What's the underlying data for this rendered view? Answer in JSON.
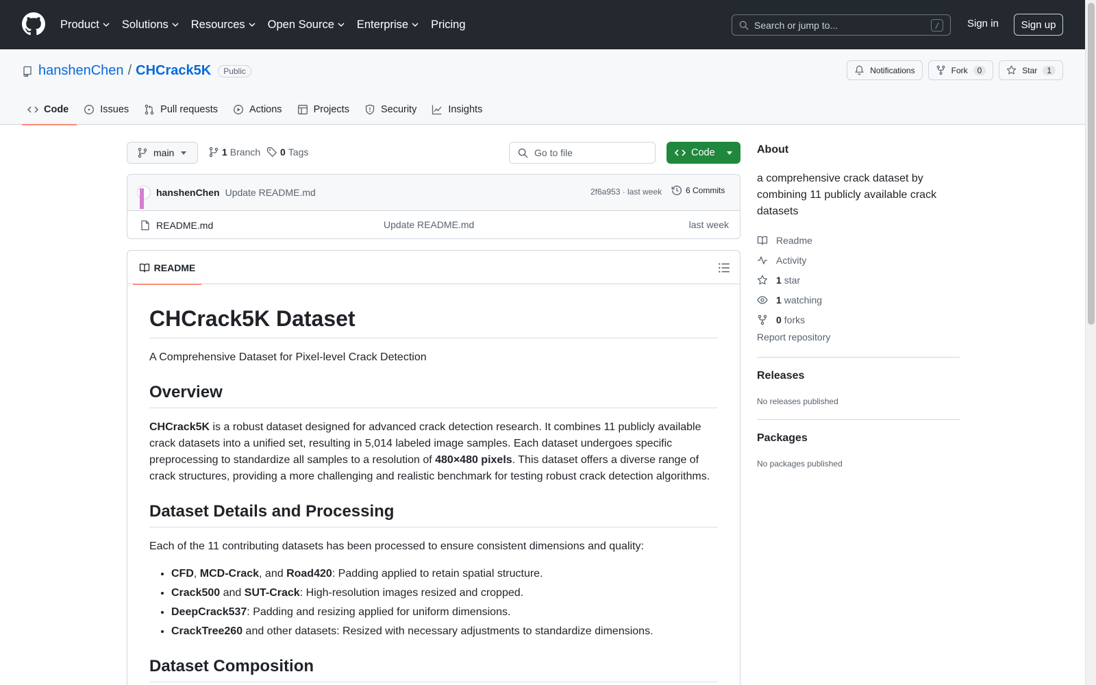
{
  "header": {
    "nav": [
      "Product",
      "Solutions",
      "Resources",
      "Open Source",
      "Enterprise",
      "Pricing"
    ],
    "search_placeholder": "Search or jump to...",
    "search_key": "/",
    "sign_in": "Sign in",
    "sign_up": "Sign up"
  },
  "repo": {
    "owner": "hanshenChen",
    "separator": "/",
    "name": "CHCrack5K",
    "visibility": "Public",
    "notifications_label": "Notifications",
    "fork_label": "Fork",
    "fork_count": "0",
    "star_label": "Star",
    "star_count": "1"
  },
  "tabs": [
    {
      "label": "Code",
      "icon": "code-icon"
    },
    {
      "label": "Issues",
      "icon": "issue-icon"
    },
    {
      "label": "Pull requests",
      "icon": "pull-request-icon"
    },
    {
      "label": "Actions",
      "icon": "play-icon"
    },
    {
      "label": "Projects",
      "icon": "table-icon"
    },
    {
      "label": "Security",
      "icon": "shield-icon"
    },
    {
      "label": "Insights",
      "icon": "graph-icon"
    }
  ],
  "toolbar": {
    "branch": "main",
    "branch_count": "1",
    "branch_label": "Branch",
    "tag_count": "0",
    "tag_label": "Tags",
    "goto_placeholder": "Go to file",
    "code_label": "Code"
  },
  "commit": {
    "author": "hanshenChen",
    "message": "Update README.md",
    "hash_time": "2f6a953 · last week",
    "commits_label": "6 Commits"
  },
  "files": [
    {
      "name": "README.md",
      "commit": "Update README.md",
      "time": "last week"
    }
  ],
  "readme": {
    "tab_label": "README",
    "title": "CHCrack5K Dataset",
    "subtitle": "A Comprehensive Dataset for Pixel-level Crack Detection",
    "overview_heading": "Overview",
    "overview": {
      "b1": "CHCrack5K",
      "t1": " is a robust dataset designed for advanced crack detection research. It combines 11 publicly available crack datasets into a unified set, resulting in 5,014 labeled image samples. Each dataset undergoes specific preprocessing to standardize all samples to a resolution of ",
      "b2": "480×480 pixels",
      "t2": ". This dataset offers a diverse range of crack structures, providing a more challenging and realistic benchmark for testing robust crack detection algorithms."
    },
    "details_heading": "Dataset Details and Processing",
    "details_intro": "Each of the 11 contributing datasets has been processed to ensure consistent dimensions and quality:",
    "list": [
      {
        "parts": [
          {
            "b": "CFD"
          },
          {
            "t": ", "
          },
          {
            "b": "MCD-Crack"
          },
          {
            "t": ", and "
          },
          {
            "b": "Road420"
          },
          {
            "t": ": Padding applied to retain spatial structure."
          }
        ]
      },
      {
        "parts": [
          {
            "b": "Crack500"
          },
          {
            "t": " and "
          },
          {
            "b": "SUT-Crack"
          },
          {
            "t": ": High-resolution images resized and cropped."
          }
        ]
      },
      {
        "parts": [
          {
            "b": "DeepCrack537"
          },
          {
            "t": ": Padding and resizing applied for uniform dimensions."
          }
        ]
      },
      {
        "parts": [
          {
            "b": "CrackTree260"
          },
          {
            "t": " and other datasets: Resized with necessary adjustments to standardize dimensions."
          }
        ]
      }
    ],
    "composition_heading": "Dataset Composition"
  },
  "sidebar": {
    "about_heading": "About",
    "description": "a comprehensive crack dataset by combining 11 publicly available crack datasets",
    "links": [
      {
        "icon": "book-icon",
        "count": "",
        "label": "Readme"
      },
      {
        "icon": "pulse-icon",
        "count": "",
        "label": "Activity"
      },
      {
        "icon": "star-icon",
        "count": "1",
        "label": "star"
      },
      {
        "icon": "eye-icon",
        "count": "1",
        "label": "watching"
      },
      {
        "icon": "fork-icon",
        "count": "0",
        "label": "forks"
      }
    ],
    "report": "Report repository",
    "releases_heading": "Releases",
    "releases_note": "No releases published",
    "packages_heading": "Packages",
    "packages_note": "No packages published"
  },
  "colors": {
    "header_bg": "#24292f",
    "link": "#0969da",
    "accent_underline": "#fd8c73",
    "code_button": "#1f883d"
  }
}
